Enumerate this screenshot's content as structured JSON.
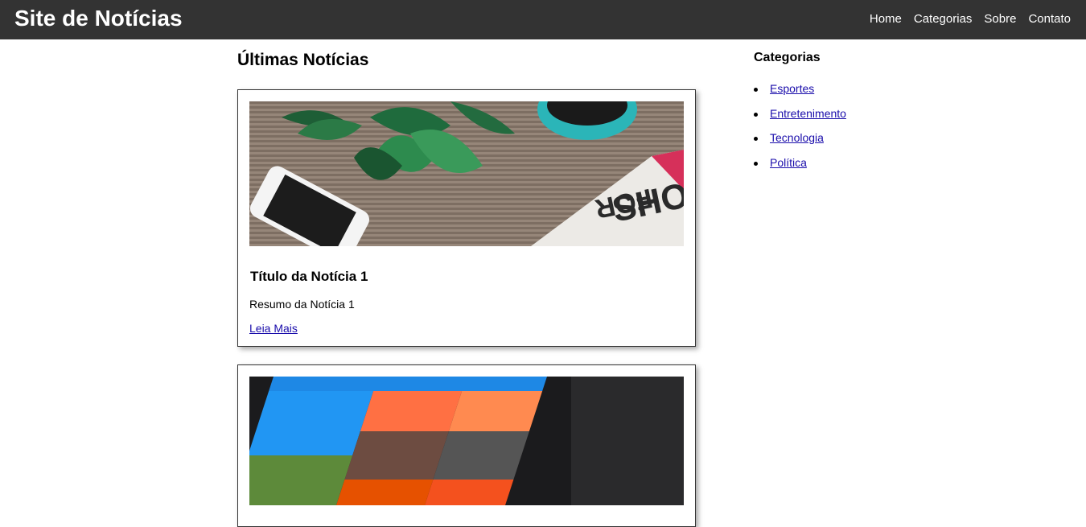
{
  "header": {
    "site_title": "Site de Notícias",
    "nav": [
      "Home",
      "Categorias",
      "Sobre",
      "Contato"
    ]
  },
  "main": {
    "heading": "Últimas Notícias",
    "articles": [
      {
        "title": "Título da Notícia 1",
        "summary": "Resumo da Notícia 1",
        "link_label": "Leia Mais",
        "image": "desk-phone-newspaper-photo"
      },
      {
        "image": "tablet-app-grid-photo"
      }
    ]
  },
  "sidebar": {
    "heading": "Categorias",
    "items": [
      "Esportes",
      "Entretenimento",
      "Tecnologia",
      "Política"
    ]
  },
  "colors": {
    "header_bg": "#333333",
    "link": "#1a0dab"
  }
}
